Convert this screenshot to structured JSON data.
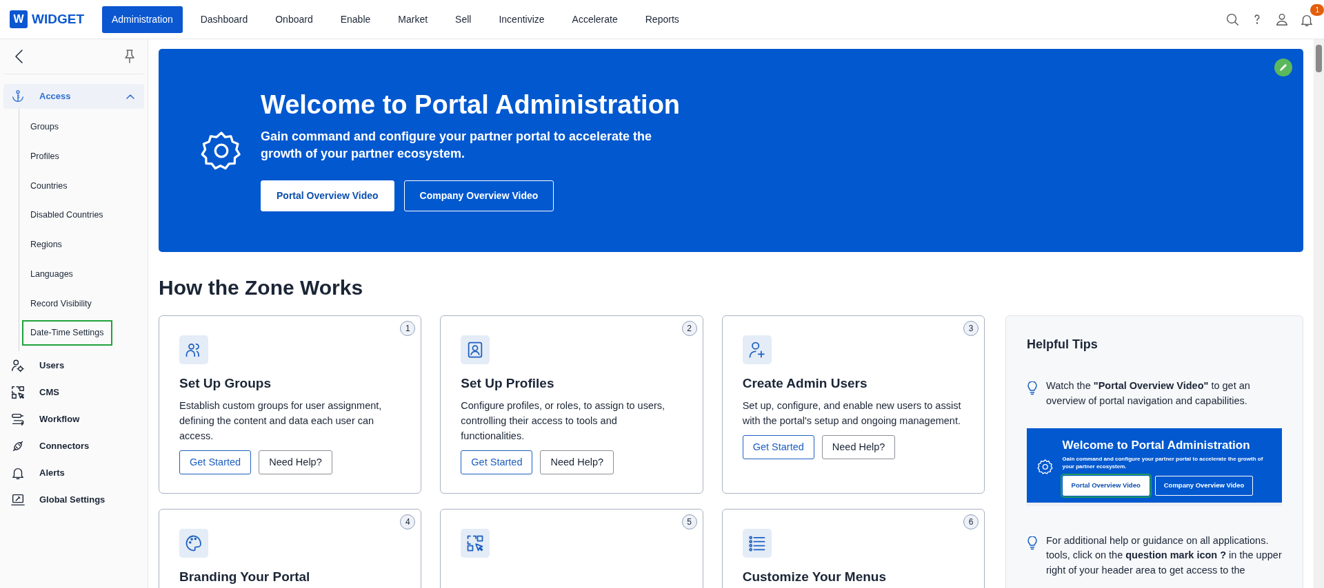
{
  "app": {
    "logo_letter": "W",
    "logo_text": "WIDGET"
  },
  "nav": [
    {
      "label": "Administration",
      "selected": true
    },
    {
      "label": "Dashboard",
      "selected": false
    },
    {
      "label": "Onboard",
      "selected": false
    },
    {
      "label": "Enable",
      "selected": false
    },
    {
      "label": "Market",
      "selected": false
    },
    {
      "label": "Sell",
      "selected": false
    },
    {
      "label": "Incentivize",
      "selected": false
    },
    {
      "label": "Accelerate",
      "selected": false
    },
    {
      "label": "Reports",
      "selected": false
    }
  ],
  "notifications": {
    "count": "1"
  },
  "sidebar": {
    "items": [
      {
        "label": "Access",
        "selected": true,
        "expanded": true,
        "children": [
          {
            "label": "Groups",
            "highlighted": false
          },
          {
            "label": "Profiles",
            "highlighted": false
          },
          {
            "label": "Countries",
            "highlighted": false
          },
          {
            "label": "Disabled Countries",
            "highlighted": false
          },
          {
            "label": "Regions",
            "highlighted": false
          },
          {
            "label": "Languages",
            "highlighted": false
          },
          {
            "label": "Record Visibility",
            "highlighted": false
          },
          {
            "label": "Date-Time Settings",
            "highlighted": true
          }
        ]
      },
      {
        "label": "Users",
        "selected": false
      },
      {
        "label": "CMS",
        "selected": false
      },
      {
        "label": "Workflow",
        "selected": false
      },
      {
        "label": "Connectors",
        "selected": false
      },
      {
        "label": "Alerts",
        "selected": false
      },
      {
        "label": "Global Settings",
        "selected": false
      }
    ]
  },
  "banner": {
    "title": "Welcome to Portal Administration",
    "subtitle": "Gain command and configure your partner portal to accelerate the growth of your partner ecosystem.",
    "buttons": [
      {
        "label": "Portal Overview Video",
        "kind": "solid"
      },
      {
        "label": "Company Overview Video",
        "kind": "outline"
      }
    ]
  },
  "section_title": "How the Zone Works",
  "cards": [
    {
      "number": "1",
      "title": "Set Up Groups",
      "description": "Establish custom groups for user assignment, defining the content and data each user can access.",
      "buttons": [
        "Get Started",
        "Need Help?"
      ]
    },
    {
      "number": "2",
      "title": "Set Up Profiles",
      "description": "Configure profiles, or roles, to assign to users, controlling their access to tools and functionalities.",
      "buttons": [
        "Get Started",
        "Need Help?"
      ]
    },
    {
      "number": "3",
      "title": "Create Admin Users",
      "description": "Set up, configure, and enable new users to assist with the portal's setup and ongoing management.",
      "buttons": [
        "Get Started",
        "Need Help?"
      ]
    },
    {
      "number": "4",
      "title": "Branding Your Portal"
    },
    {
      "number": "5"
    },
    {
      "number": "6",
      "title": "Customize Your Menus"
    }
  ],
  "tips": {
    "title": "Helpful Tips",
    "first_tip": "Watch the **\"Portal Overview Video\"** to get an overview of portal navigation and capabilities.",
    "preview": {
      "title": "Welcome to Portal Administration",
      "subtitle": "Gain command and configure your partner portal to accelerate the growth of your partner ecosystem.",
      "buttons": [
        {
          "label": "Portal Overview Video",
          "kind": "solid",
          "highlighted": true
        },
        {
          "label": "Company Overview Video",
          "kind": "outline",
          "highlighted": false
        }
      ]
    },
    "second_tip": "For additional help or guidance on all applications. tools, click on the **question mark icon ?** in the upper right of your header area to get access to the"
  }
}
